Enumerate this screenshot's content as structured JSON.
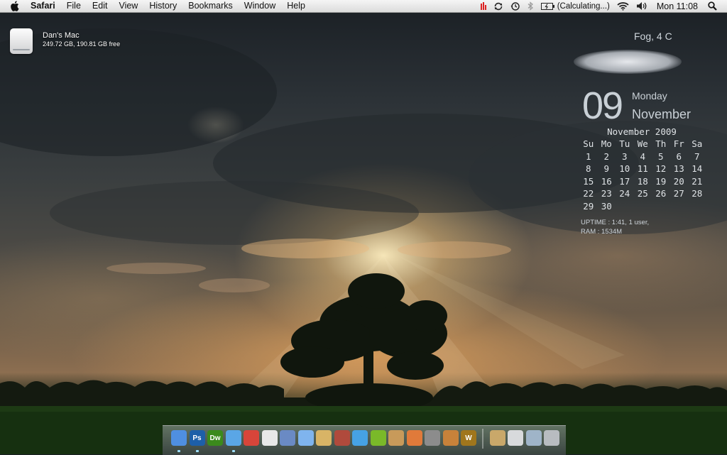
{
  "menubar": {
    "apple_icon": "apple-logo",
    "app_name": "Safari",
    "menus": [
      "File",
      "Edit",
      "View",
      "History",
      "Bookmarks",
      "Window",
      "Help"
    ],
    "status": {
      "battery_text": "(Calculating...)",
      "clock": "Mon 11:08",
      "icons": [
        "activity-indicator-icon",
        "sync-icon",
        "time-machine-icon",
        "bluetooth-icon",
        "battery-icon",
        "wifi-icon",
        "volume-icon",
        "spotlight-icon"
      ]
    }
  },
  "desktop": {
    "drive": {
      "name": "Dan's Mac",
      "info": "249.72 GB, 190.81 GB free"
    }
  },
  "widgets": {
    "weather": "Fog, 4 C",
    "date": {
      "day": "09",
      "weekday": "Monday",
      "month": "November"
    },
    "calendar": {
      "title": "November 2009",
      "weekdays": [
        "Su",
        "Mo",
        "Tu",
        "We",
        "Th",
        "Fr",
        "Sa"
      ],
      "weeks": [
        [
          "1",
          "2",
          "3",
          "4",
          "5",
          "6",
          "7"
        ],
        [
          "8",
          "9",
          "10",
          "11",
          "12",
          "13",
          "14"
        ],
        [
          "15",
          "16",
          "17",
          "18",
          "19",
          "20",
          "21"
        ],
        [
          "22",
          "23",
          "24",
          "25",
          "26",
          "27",
          "28"
        ],
        [
          "29",
          "30",
          "",
          "",
          "",
          "",
          ""
        ]
      ]
    },
    "sysinfo": {
      "uptime": "UPTIME : 1:41, 1 user,",
      "ram": "RAM : 1534M"
    }
  },
  "dock": {
    "apps": [
      {
        "name": "finder",
        "label": "",
        "color": "#4f8fe0",
        "running": true
      },
      {
        "name": "photoshop",
        "label": "Ps",
        "color": "#1d5fa8",
        "running": true
      },
      {
        "name": "dreamweaver",
        "label": "Dw",
        "color": "#3b8a1c",
        "running": false
      },
      {
        "name": "safari",
        "label": "",
        "color": "#5aa6e6",
        "running": true
      },
      {
        "name": "chrome",
        "label": "",
        "color": "#d8453a",
        "running": false
      },
      {
        "name": "mouse",
        "label": "",
        "color": "#e8e8e8",
        "running": false
      },
      {
        "name": "preview",
        "label": "",
        "color": "#6a8ac4",
        "running": false
      },
      {
        "name": "ichat",
        "label": "",
        "color": "#7fb4ee",
        "running": false
      },
      {
        "name": "notes",
        "label": "",
        "color": "#d8b466",
        "running": false
      },
      {
        "name": "address-book",
        "label": "",
        "color": "#b04a3c",
        "running": false
      },
      {
        "name": "itunes",
        "label": "",
        "color": "#46a2e4",
        "running": false
      },
      {
        "name": "spotify",
        "label": "",
        "color": "#7ab929",
        "running": false
      },
      {
        "name": "iphoto",
        "label": "",
        "color": "#c89a5a",
        "running": false
      },
      {
        "name": "image-capture",
        "label": "",
        "color": "#e07a3a",
        "running": false
      },
      {
        "name": "imovie",
        "label": "",
        "color": "#8c8c8c",
        "running": false
      },
      {
        "name": "garageband",
        "label": "",
        "color": "#c8823a",
        "running": false
      },
      {
        "name": "warcraft",
        "label": "W",
        "color": "#a0761c",
        "running": false
      }
    ],
    "docs": [
      {
        "name": "documents-folder",
        "color": "#c9a86a"
      },
      {
        "name": "drive",
        "color": "#d8dadc"
      },
      {
        "name": "downloads-stack",
        "color": "#9fb4c8"
      },
      {
        "name": "trash",
        "color": "#b8bcc0"
      }
    ]
  }
}
